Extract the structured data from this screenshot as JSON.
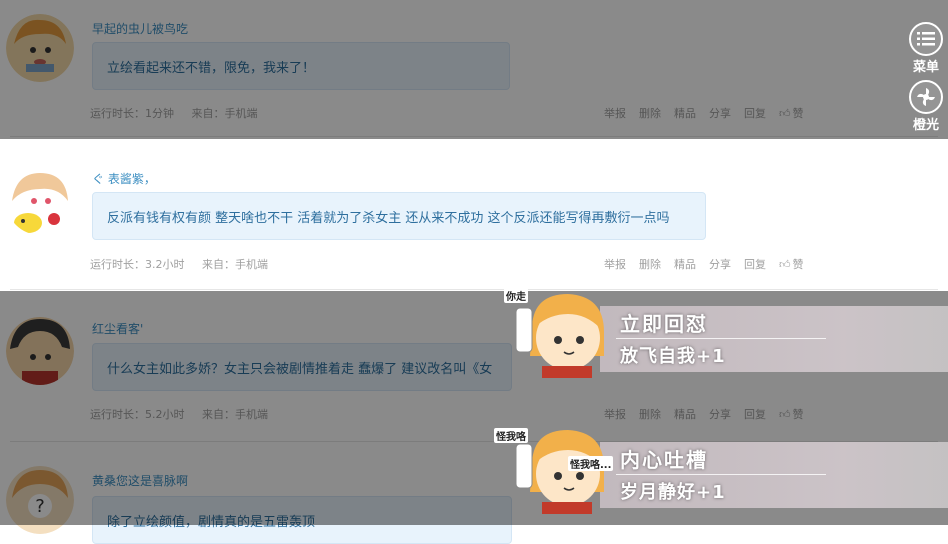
{
  "comments": [
    {
      "username": "早起的虫儿被鸟吃",
      "text": "立绘看起来还不错，限免，我来了！",
      "runtime": "运行时长：1分钟",
      "source": "来自：手机端"
    },
    {
      "username": "ぐ 表酱紫，",
      "text": "反派有钱有权有颜 整天啥也不干 活着就为了杀女主 还从来不成功 这个反派还能写得再敷衍一点吗",
      "runtime": "运行时长：3.2小时",
      "source": "来自：手机端"
    },
    {
      "username": "红尘看客'",
      "text": "什么女主如此多娇？女主只会被剧情推着走 蠢爆了 建议改名叫《女",
      "runtime": "运行时长：5.2小时",
      "source": "来自：手机端"
    },
    {
      "username": "黄桑您这是喜脉啊",
      "text": "除了立绘颜值，剧情真的是五雷轰顶"
    }
  ],
  "actions": {
    "report": "举报",
    "delete": "删除",
    "featured": "精品",
    "share": "分享",
    "reply": "回复",
    "like": "赞"
  },
  "side": {
    "menu_label": "菜单",
    "orange_label": "橙光"
  },
  "popup": {
    "option1": {
      "title": "立即回怼",
      "subtitle": "放飞自我+1",
      "tag": "你走"
    },
    "option2": {
      "title": "内心吐槽",
      "subtitle": "岁月静好+1",
      "tag": "怪我咯...",
      "tag_small": "怪我咯"
    }
  },
  "colors": {
    "username": "#3d8fc2",
    "bubble_bg": "#e8f3fc",
    "bubble_text": "#2e6f9e",
    "meta": "#a0a0a0",
    "overlay": "rgba(0,0,0,0.46)"
  }
}
